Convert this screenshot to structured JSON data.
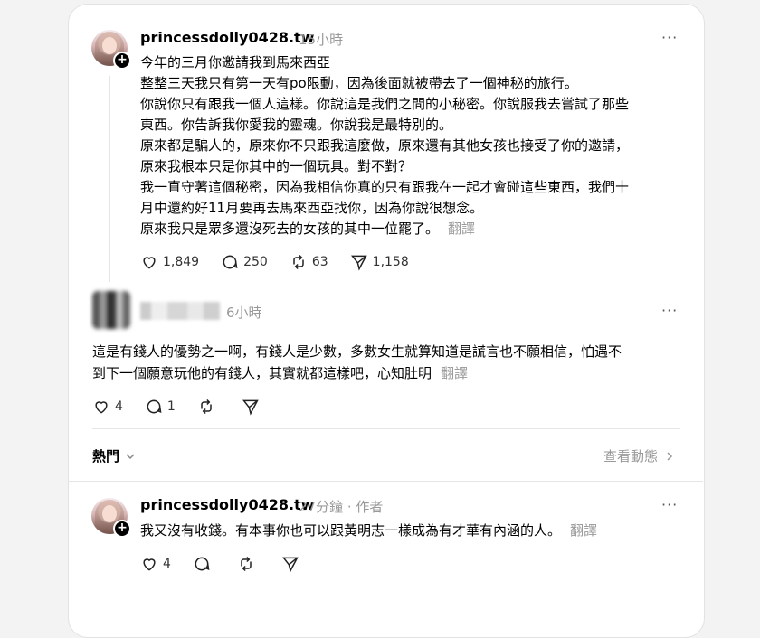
{
  "post": {
    "username": "princessdolly0428.tw",
    "time": "15小時",
    "more": "···",
    "lines": [
      "今年的三月你邀請我到馬來西亞",
      "整整三天我只有第一天有po限動，因為後面就被帶去了一個神秘的旅行。",
      "你說你只有跟我一個人這樣。你說這是我們之間的小秘密。你說服我去嘗試了那些",
      "東西。你告訴我你愛我的靈魂。你說我是最特別的。",
      "原來都是騙人的，原來你不只跟我這麼做，原來還有其他女孩也接受了你的邀請，",
      "原來我根本只是你其中的一個玩具。對不對？",
      "我一直守著這個秘密，因為我相信你真的只有跟我在一起才會碰這些東西，我們十",
      "月中還約好11月要再去馬來西亞找你，因為你說很想念。",
      "原來我只是眾多還沒死去的女孩的其中一位罷了。"
    ],
    "translate": "翻譯",
    "likes": "1,849",
    "comments": "250",
    "reposts": "63",
    "shares": "1,158"
  },
  "reply1": {
    "time": "6小時",
    "more": "···",
    "lines": [
      "這是有錢人的優勢之一啊，有錢人是少數，多數女生就算知道是謊言也不願相信，怕遇不",
      "到下一個願意玩他的有錢人，其實就都這樣吧，心知肚明"
    ],
    "translate": "翻譯",
    "likes": "4",
    "comments": "1"
  },
  "sort": {
    "label": "熱門",
    "activity": "查看動態"
  },
  "reply2": {
    "username": "princessdolly0428.tw",
    "time": "27分鐘",
    "author_tag": "作者",
    "more": "···",
    "text": "我又沒有收錢。有本事你也可以跟黃明志一樣成為有才華有內涵的人。",
    "translate": "翻譯",
    "likes": "4"
  }
}
